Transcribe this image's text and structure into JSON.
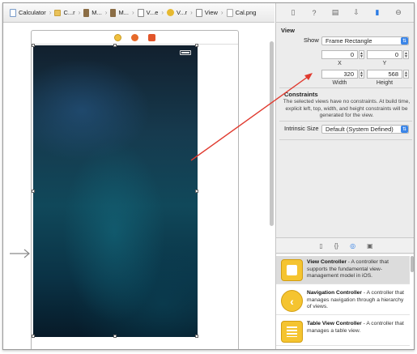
{
  "jumpbar": {
    "crumbs": [
      {
        "label": "Calculator",
        "icon": "project-file-icon"
      },
      {
        "label": "C...r",
        "icon": "folder-icon"
      },
      {
        "label": "M...",
        "icon": "storyboard-icon"
      },
      {
        "label": "M...",
        "icon": "storyboard-icon"
      },
      {
        "label": "V...e",
        "icon": "scene-icon"
      },
      {
        "label": "V...r",
        "icon": "view-controller-icon"
      },
      {
        "label": "View",
        "icon": "view-icon"
      },
      {
        "label": "Cal.png",
        "icon": "image-file-icon"
      }
    ]
  },
  "inspector": {
    "tabs": [
      "file-inspector-icon",
      "quick-help-icon",
      "identity-inspector-icon",
      "attributes-inspector-icon",
      "size-inspector-icon",
      "connections-inspector-icon"
    ],
    "section_title": "View",
    "show_label": "Show",
    "show_value": "Frame Rectangle",
    "x_value": "0",
    "y_value": "0",
    "x_label": "X",
    "y_label": "Y",
    "width_value": "320",
    "height_value": "568",
    "width_label": "Width",
    "height_label": "Height",
    "constraints_title": "Constraints",
    "constraints_text": "The selected views have no constraints. At build time, explicit left, top, width, and height constraints will be generated for the view.",
    "intrinsic_label": "Intrinsic Size",
    "intrinsic_value": "Default (System Defined)"
  },
  "library": {
    "tabs": [
      "file-template-icon",
      "code-snippet-icon",
      "object-library-icon",
      "media-library-icon"
    ],
    "items": [
      {
        "title": "View Controller",
        "desc": " - A controller that supports the fundamental view-management model in iOS."
      },
      {
        "title": "Navigation Controller",
        "desc": " - A controller that manages navigation through a hierarchy of views."
      },
      {
        "title": "Table View Controller",
        "desc": " - A controller that manages a table view."
      }
    ]
  },
  "colors": {
    "accent": "#2a7be4",
    "arrow": "#e03a2f",
    "vc_yellow": "#f5c430"
  }
}
